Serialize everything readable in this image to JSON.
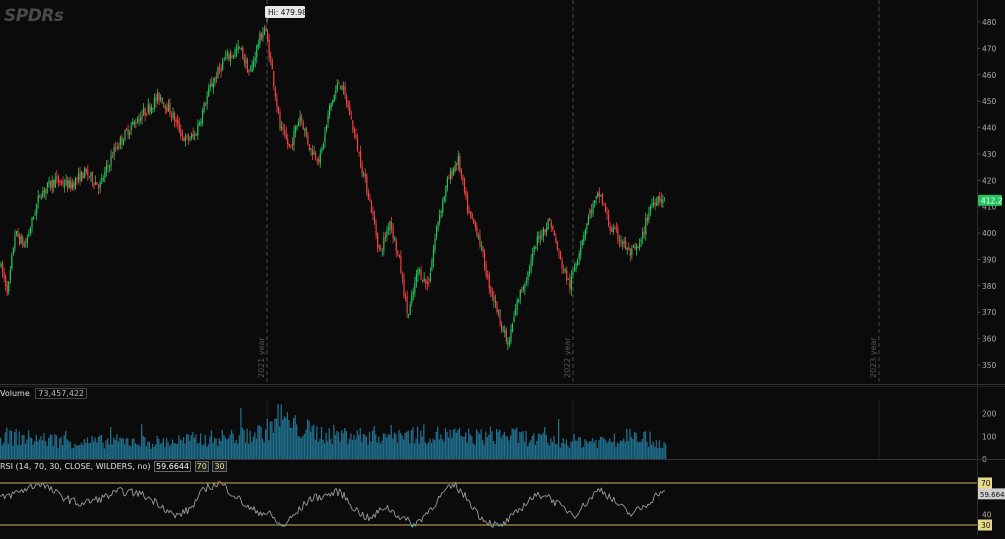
{
  "logo": "SPDRs",
  "hi_label": "Hi: 479.98",
  "last_price_label": "412.2",
  "volume_label": "Volume",
  "volume_value": "73,457,422",
  "rsi_label": "RSI (14, 70, 30, CLOSE, WILDERS, no)",
  "rsi_value": "59.6644",
  "rsi_ob": "70",
  "rsi_os": "30",
  "colors": {
    "up": "#22c55e",
    "down": "#ef4444",
    "volume": "#1f6e8c",
    "rsi_line": "#9a9a9a",
    "rsi_ob_line": "#c9b458",
    "rsi_os_line": "#c9b458",
    "price_tag": "#22c55e"
  },
  "chart_data": [
    {
      "type": "candlestick",
      "title": "",
      "ylim": [
        345,
        485
      ],
      "yticks": [
        "480",
        "470",
        "460",
        "450",
        "440",
        "430",
        "420",
        "410",
        "400",
        "390",
        "380",
        "370",
        "360",
        "350"
      ],
      "year_markers": [
        "2021 year",
        "2022 year",
        "2023 year"
      ],
      "high": 479.98,
      "last": 412.2,
      "price_path": [
        [
          0,
          388
        ],
        [
          8,
          378
        ],
        [
          15,
          400
        ],
        [
          25,
          395
        ],
        [
          40,
          415
        ],
        [
          55,
          420
        ],
        [
          70,
          418
        ],
        [
          85,
          423
        ],
        [
          100,
          418
        ],
        [
          115,
          432
        ],
        [
          130,
          440
        ],
        [
          145,
          446
        ],
        [
          160,
          452
        ],
        [
          172,
          445
        ],
        [
          185,
          435
        ],
        [
          195,
          437
        ],
        [
          210,
          455
        ],
        [
          225,
          466
        ],
        [
          240,
          470
        ],
        [
          250,
          460
        ],
        [
          258,
          472
        ],
        [
          265,
          478
        ],
        [
          272,
          462
        ],
        [
          280,
          440
        ],
        [
          290,
          432
        ],
        [
          300,
          445
        ],
        [
          310,
          432
        ],
        [
          320,
          428
        ],
        [
          330,
          448
        ],
        [
          340,
          458
        ],
        [
          350,
          445
        ],
        [
          360,
          428
        ],
        [
          370,
          412
        ],
        [
          380,
          392
        ],
        [
          390,
          405
        ],
        [
          400,
          388
        ],
        [
          408,
          368
        ],
        [
          418,
          386
        ],
        [
          428,
          380
        ],
        [
          438,
          405
        ],
        [
          448,
          420
        ],
        [
          458,
          428
        ],
        [
          468,
          408
        ],
        [
          478,
          400
        ],
        [
          488,
          382
        ],
        [
          498,
          370
        ],
        [
          508,
          357
        ],
        [
          518,
          375
        ],
        [
          528,
          385
        ],
        [
          538,
          398
        ],
        [
          550,
          405
        ],
        [
          560,
          390
        ],
        [
          570,
          380
        ],
        [
          580,
          395
        ],
        [
          590,
          408
        ],
        [
          600,
          415
        ],
        [
          610,
          402
        ],
        [
          620,
          398
        ],
        [
          630,
          392
        ],
        [
          640,
          395
        ],
        [
          650,
          410
        ],
        [
          658,
          414
        ],
        [
          665,
          412
        ]
      ]
    },
    {
      "type": "bar",
      "title": "Volume",
      "ylim": [
        0,
        260
      ],
      "yticks": [
        "200",
        "100",
        "0"
      ],
      "volume_path": [
        [
          0,
          110
        ],
        [
          40,
          95
        ],
        [
          80,
          80
        ],
        [
          120,
          85
        ],
        [
          160,
          80
        ],
        [
          200,
          95
        ],
        [
          240,
          110
        ],
        [
          265,
          130
        ],
        [
          280,
          210
        ],
        [
          290,
          160
        ],
        [
          320,
          120
        ],
        [
          360,
          110
        ],
        [
          400,
          120
        ],
        [
          440,
          115
        ],
        [
          480,
          105
        ],
        [
          500,
          120
        ],
        [
          540,
          90
        ],
        [
          580,
          85
        ],
        [
          620,
          90
        ],
        [
          632,
          150
        ],
        [
          645,
          100
        ],
        [
          665,
          70
        ]
      ]
    },
    {
      "type": "line",
      "title": "RSI",
      "ylim": [
        25,
        75
      ],
      "yticks": [
        "70",
        "40",
        "30"
      ],
      "rsi_path": [
        [
          0,
          55
        ],
        [
          20,
          62
        ],
        [
          40,
          70
        ],
        [
          60,
          58
        ],
        [
          80,
          50
        ],
        [
          100,
          55
        ],
        [
          120,
          62
        ],
        [
          140,
          60
        ],
        [
          160,
          50
        ],
        [
          175,
          38
        ],
        [
          190,
          45
        ],
        [
          205,
          65
        ],
        [
          220,
          70
        ],
        [
          235,
          58
        ],
        [
          250,
          45
        ],
        [
          270,
          40
        ],
        [
          282,
          28
        ],
        [
          295,
          40
        ],
        [
          310,
          55
        ],
        [
          325,
          58
        ],
        [
          340,
          62
        ],
        [
          355,
          45
        ],
        [
          370,
          35
        ],
        [
          385,
          48
        ],
        [
          400,
          38
        ],
        [
          415,
          30
        ],
        [
          430,
          45
        ],
        [
          445,
          62
        ],
        [
          455,
          68
        ],
        [
          470,
          52
        ],
        [
          480,
          38
        ],
        [
          490,
          32
        ],
        [
          500,
          28
        ],
        [
          515,
          40
        ],
        [
          530,
          55
        ],
        [
          545,
          60
        ],
        [
          560,
          48
        ],
        [
          575,
          40
        ],
        [
          590,
          55
        ],
        [
          600,
          65
        ],
        [
          615,
          52
        ],
        [
          630,
          40
        ],
        [
          645,
          48
        ],
        [
          660,
          62
        ],
        [
          665,
          59.66
        ]
      ]
    }
  ]
}
